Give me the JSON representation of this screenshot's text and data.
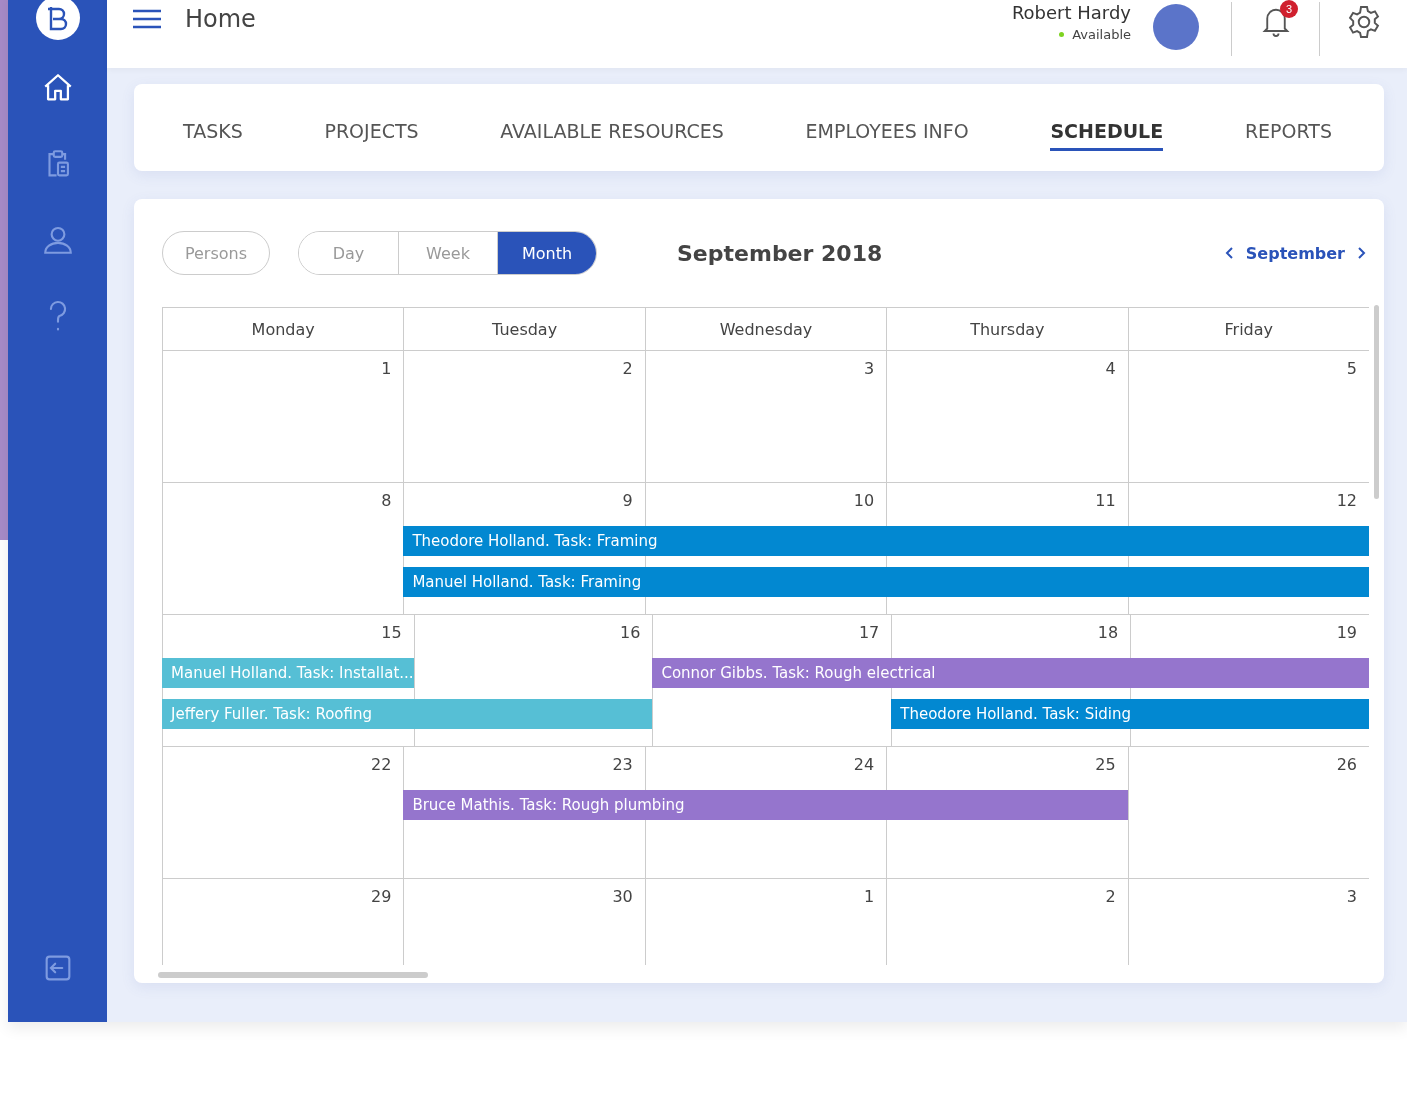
{
  "sidebar": {
    "items": [
      {
        "kind": "home",
        "selected": true
      },
      {
        "kind": "clipboard",
        "selected": false
      },
      {
        "kind": "user",
        "selected": false
      },
      {
        "kind": "help",
        "selected": false
      }
    ],
    "footer": {
      "kind": "logout"
    }
  },
  "header": {
    "title": "Home",
    "user": {
      "name": "Robert Hardy",
      "status": "Available",
      "available": true
    },
    "notifications": {
      "count": "3"
    }
  },
  "nav_tabs": [
    {
      "label": "TASKS",
      "selected": false
    },
    {
      "label": "PROJECTS",
      "selected": false
    },
    {
      "label": "AVAILABLE RESOURCES",
      "selected": false
    },
    {
      "label": "EMPLOYEES INFO",
      "selected": false
    },
    {
      "label": "SCHEDULE",
      "selected": true
    },
    {
      "label": "REPORTS",
      "selected": false
    }
  ],
  "toolbar": {
    "persons": "Persons",
    "views": [
      {
        "label": "Day",
        "selected": false
      },
      {
        "label": "Week",
        "selected": false
      },
      {
        "label": "Month",
        "selected": true
      }
    ],
    "title": "September 2018",
    "month_nav": "September"
  },
  "calendar": {
    "days": [
      "Monday",
      "Tuesday",
      "Wednesday",
      "Thursday",
      "Friday"
    ],
    "weeks": [
      {
        "dates": [
          "1",
          "2",
          "3",
          "4",
          "5"
        ]
      },
      {
        "dates": [
          "8",
          "9",
          "10",
          "11",
          "12"
        ],
        "lanes": [
          [
            {
              "text": "Theodore Holland. Task: Framing",
              "color": "#0288d1",
              "covers": [
                false,
                true,
                true,
                true,
                true
              ]
            }
          ],
          [
            {
              "text": "Manuel Holland. Task: Framing",
              "color": "#0288d1",
              "covers": [
                false,
                true,
                true,
                true,
                true
              ]
            }
          ]
        ]
      },
      {
        "dates": [
          "15",
          "16",
          "17",
          "18",
          "19"
        ],
        "lanes": [
          [
            {
              "text": "Manuel Holland. Task: Installat...",
              "color": "#56bfd5",
              "covers": [
                true,
                false,
                false,
                false,
                false
              ]
            },
            {
              "text": "Connor Gibbs. Task: Rough electrical",
              "color": "#9575cd",
              "covers": [
                false,
                false,
                true,
                true,
                true
              ]
            }
          ],
          [
            {
              "text": "Jeffery Fuller. Task: Roofing",
              "color": "#56bfd5",
              "covers": [
                true,
                true,
                false,
                false,
                false
              ]
            },
            {
              "text": "Theodore Holland. Task: Siding",
              "color": "#0288d1",
              "covers": [
                false,
                false,
                false,
                true,
                true
              ]
            }
          ]
        ]
      },
      {
        "dates": [
          "22",
          "23",
          "24",
          "25",
          "26"
        ],
        "lanes": [
          [
            {
              "text": "Bruce Mathis. Task: Rough plumbing",
              "color": "#9575cd",
              "covers": [
                false,
                true,
                true,
                true,
                false
              ]
            }
          ]
        ]
      },
      {
        "dates": [
          "29",
          "30",
          "1",
          "2",
          "3"
        ]
      }
    ]
  }
}
